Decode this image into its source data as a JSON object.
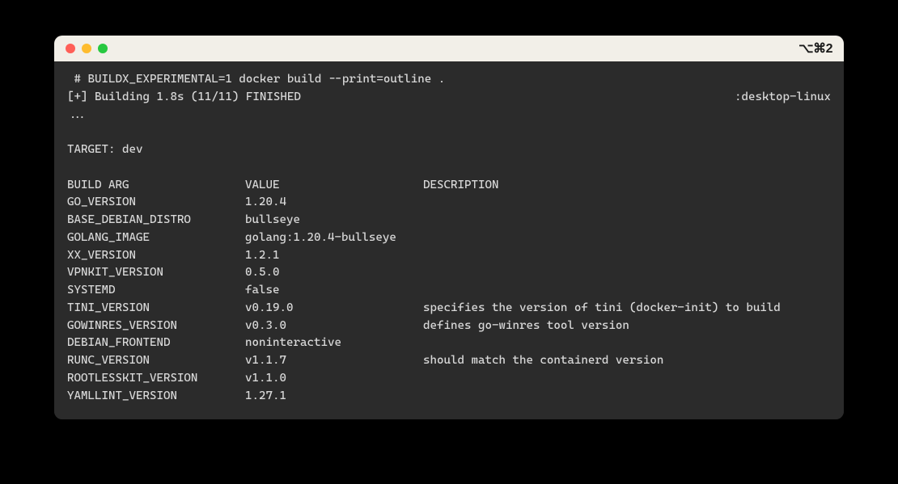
{
  "titlebar": {
    "shortcut": "⌥⌘2"
  },
  "terminal": {
    "command_line": " # BUILDX_EXPERIMENTAL=1 docker build --print=outline .",
    "status_left": "[+] Building 1.8s (11/11) FINISHED",
    "status_right": ":desktop-linux",
    "ellipsis": "...",
    "target_line": "TARGET: dev",
    "headers": {
      "arg": "BUILD ARG",
      "value": "VALUE",
      "description": "DESCRIPTION"
    },
    "rows": [
      {
        "arg": "GO_VERSION",
        "value": "1.20.4",
        "description": ""
      },
      {
        "arg": "BASE_DEBIAN_DISTRO",
        "value": "bullseye",
        "description": ""
      },
      {
        "arg": "GOLANG_IMAGE",
        "value": "golang:1.20.4-bullseye",
        "description": ""
      },
      {
        "arg": "XX_VERSION",
        "value": "1.2.1",
        "description": ""
      },
      {
        "arg": "VPNKIT_VERSION",
        "value": "0.5.0",
        "description": ""
      },
      {
        "arg": "SYSTEMD",
        "value": "false",
        "description": ""
      },
      {
        "arg": "TINI_VERSION",
        "value": "v0.19.0",
        "description": "specifies the version of tini (docker-init) to build"
      },
      {
        "arg": "GOWINRES_VERSION",
        "value": "v0.3.0",
        "description": "defines go-winres tool version"
      },
      {
        "arg": "DEBIAN_FRONTEND",
        "value": "noninteractive",
        "description": ""
      },
      {
        "arg": "RUNC_VERSION",
        "value": "v1.1.7",
        "description": "should match the containerd version"
      },
      {
        "arg": "ROOTLESSKIT_VERSION",
        "value": "v1.1.0",
        "description": ""
      },
      {
        "arg": "YAMLLINT_VERSION",
        "value": "1.27.1",
        "description": ""
      }
    ]
  }
}
